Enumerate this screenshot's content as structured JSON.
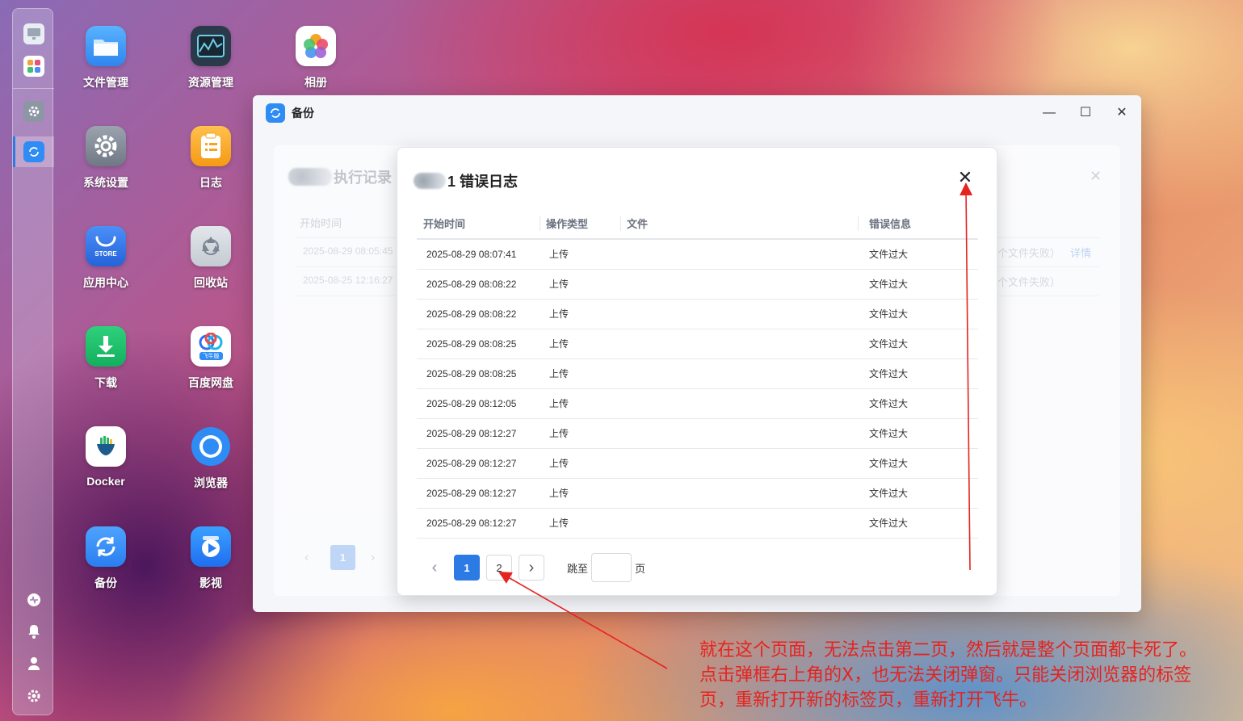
{
  "desktop": {
    "icons": [
      {
        "label": "文件管理"
      },
      {
        "label": "资源管理"
      },
      {
        "label": "相册"
      },
      {
        "label": "系统设置"
      },
      {
        "label": "日志"
      },
      {
        "label": "应用中心"
      },
      {
        "label": "回收站"
      },
      {
        "label": "下载"
      },
      {
        "label": "百度网盘"
      },
      {
        "label": "Docker"
      },
      {
        "label": "浏览器"
      },
      {
        "label": "备份"
      },
      {
        "label": "影视"
      }
    ],
    "store_badge": "STORE",
    "baidu_badge": "飞牛版"
  },
  "window": {
    "title": "备份",
    "background_panel": {
      "title": "执行记录",
      "header_start_time": "开始时间",
      "rows": [
        {
          "time": "2025-08-29 08:05:45",
          "info": "个文件失败）",
          "link": "详情"
        },
        {
          "time": "2025-08-25 12:16:27",
          "info": "个文件失败）"
        }
      ],
      "page": "1"
    }
  },
  "modal": {
    "title": "1 错误日志",
    "columns": [
      "开始时间",
      "操作类型",
      "文件",
      "错误信息"
    ],
    "rows": [
      {
        "time": "2025-08-29 08:07:41",
        "op": "上传",
        "file": "",
        "error": "文件过大"
      },
      {
        "time": "2025-08-29 08:08:22",
        "op": "上传",
        "file": "",
        "error": "文件过大"
      },
      {
        "time": "2025-08-29 08:08:22",
        "op": "上传",
        "file": "",
        "error": "文件过大"
      },
      {
        "time": "2025-08-29 08:08:25",
        "op": "上传",
        "file": "",
        "error": "文件过大"
      },
      {
        "time": "2025-08-29 08:08:25",
        "op": "上传",
        "file": "",
        "error": "文件过大"
      },
      {
        "time": "2025-08-29 08:12:05",
        "op": "上传",
        "file": "",
        "error": "文件过大"
      },
      {
        "time": "2025-08-29 08:12:27",
        "op": "上传",
        "file": "",
        "error": "文件过大"
      },
      {
        "time": "2025-08-29 08:12:27",
        "op": "上传",
        "file": "",
        "error": "文件过大"
      },
      {
        "time": "2025-08-29 08:12:27",
        "op": "上传",
        "file": "",
        "error": "文件过大"
      },
      {
        "time": "2025-08-29 08:12:27",
        "op": "上传",
        "file": "",
        "error": "文件过大"
      }
    ],
    "pager": {
      "pages": [
        "1",
        "2"
      ],
      "current": "1",
      "jump_prefix": "跳至",
      "jump_suffix": "页",
      "jump_value": ""
    }
  },
  "annotation": {
    "lines": [
      "就在这个页面，无法点击第二页，然后就是整个页面都卡死了。",
      "点击弹框右上角的X，也无法关闭弹窗。只能关闭浏览器的标签",
      "页，重新打开新的标签页，重新打开飞牛。"
    ]
  },
  "colors": {
    "accent": "#2c7be5",
    "annotation": "#e5231f"
  }
}
